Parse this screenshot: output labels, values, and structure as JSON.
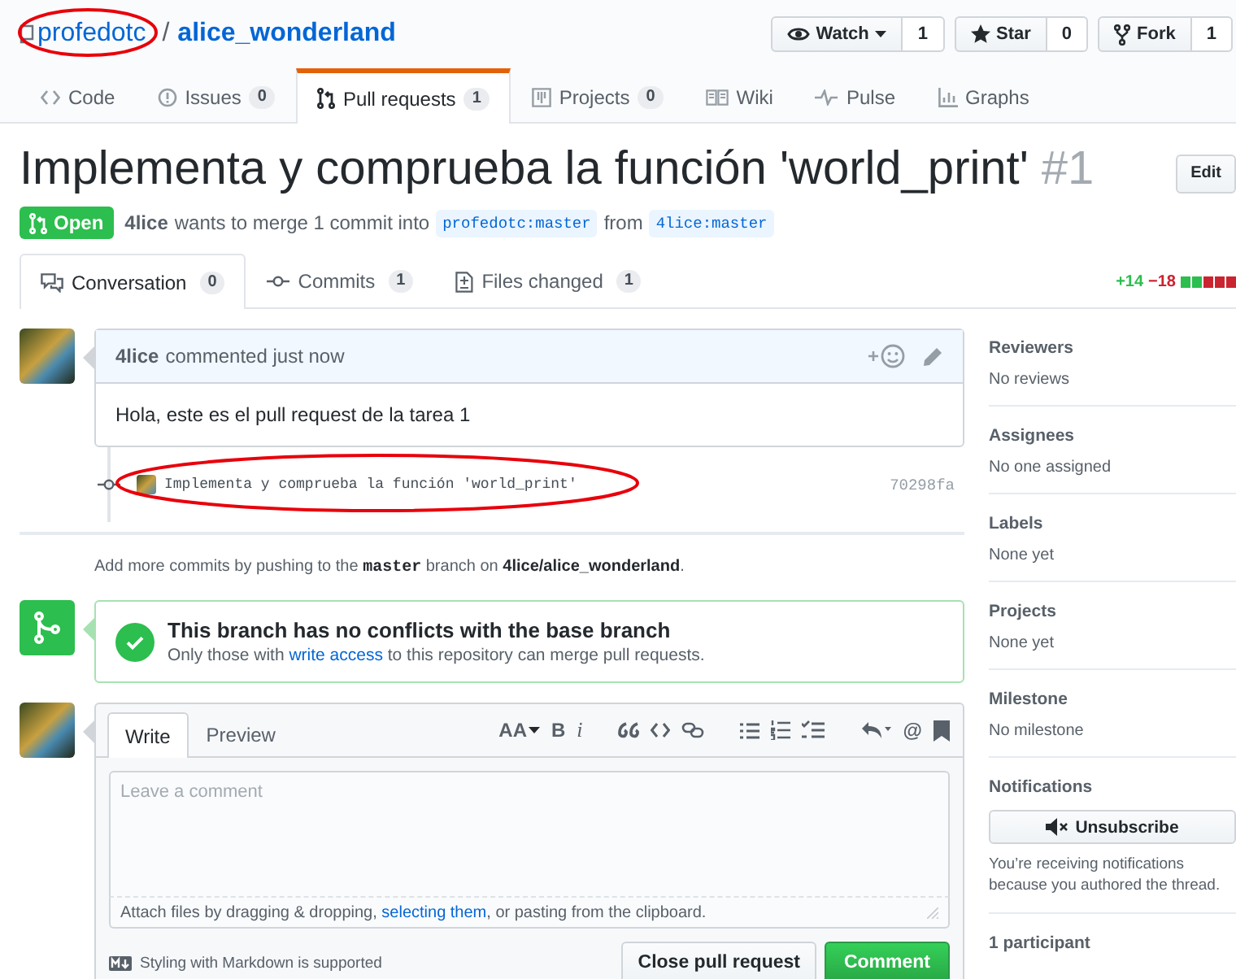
{
  "repo": {
    "owner": "profedotc",
    "separator": "/",
    "name": "alice_wonderland"
  },
  "repo_actions": [
    {
      "label": "Watch",
      "count": "1"
    },
    {
      "label": "Star",
      "count": "0"
    },
    {
      "label": "Fork",
      "count": "1"
    }
  ],
  "repo_nav": [
    {
      "label": "Code",
      "selected": false
    },
    {
      "label": "Issues",
      "count": "0",
      "selected": false
    },
    {
      "label": "Pull requests",
      "count": "1",
      "selected": true
    },
    {
      "label": "Projects",
      "count": "0",
      "selected": false
    },
    {
      "label": "Wiki",
      "selected": false
    },
    {
      "label": "Pulse",
      "selected": false
    },
    {
      "label": "Graphs",
      "selected": false
    }
  ],
  "pr": {
    "title": "Implementa y comprueba la función 'world_print'",
    "number": "#1",
    "edit_button": "Edit",
    "state": "Open",
    "author": "4lice",
    "merge_text": "wants to merge 1 commit into",
    "base_branch": "profedotc:master",
    "from_text": "from",
    "head_branch": "4lice:master"
  },
  "pr_tabs": [
    {
      "label": "Conversation",
      "count": "0",
      "selected": true
    },
    {
      "label": "Commits",
      "count": "1",
      "selected": false
    },
    {
      "label": "Files changed",
      "count": "1",
      "selected": false
    }
  ],
  "diffstat": {
    "additions": "+14",
    "deletions": "−18"
  },
  "comment": {
    "author": "4lice",
    "meta": "commented just now",
    "body": "Hola, este es el pull request de la tarea 1"
  },
  "commits": [
    {
      "message": "Implementa y comprueba la función 'world_print'",
      "sha": "70298fa"
    }
  ],
  "push_hint": "Add more commits by pushing to the **master** branch on **4lice/alice_wonderland**.",
  "merge_status": {
    "title": "This branch has no conflicts with the base branch",
    "note_before": "Only those with",
    "note_link": "write access",
    "note_after": "to this repository can merge pull requests."
  },
  "composer": {
    "tabs": [
      {
        "label": "Write",
        "selected": true
      },
      {
        "label": "Preview",
        "selected": false
      }
    ],
    "toolbar_glyphs": [
      "AA",
      "B",
      "i",
      "@"
    ],
    "placeholder": "Leave a comment",
    "attach_before": "Attach files by dragging & dropping,",
    "attach_link": "selecting them",
    "attach_after": ", or pasting from the clipboard.",
    "markdown_note": "Styling with Markdown is supported",
    "buttons": [
      {
        "label": "Close pull request",
        "kind": "default"
      },
      {
        "label": "Comment",
        "kind": "primary"
      }
    ]
  },
  "sidebar": [
    {
      "kind": "info",
      "heading": "Reviewers",
      "value": "No reviews"
    },
    {
      "kind": "info",
      "heading": "Assignees",
      "value": "No one assigned"
    },
    {
      "kind": "info",
      "heading": "Labels",
      "value": "None yet"
    },
    {
      "kind": "info",
      "heading": "Projects",
      "value": "None yet"
    },
    {
      "kind": "info",
      "heading": "Milestone",
      "value": "No milestone"
    },
    {
      "kind": "notifications",
      "heading": "Notifications",
      "button": "Unsubscribe",
      "note": "You’re receiving notifications because you authored the thread."
    },
    {
      "kind": "heading",
      "heading": "1 participant"
    }
  ]
}
